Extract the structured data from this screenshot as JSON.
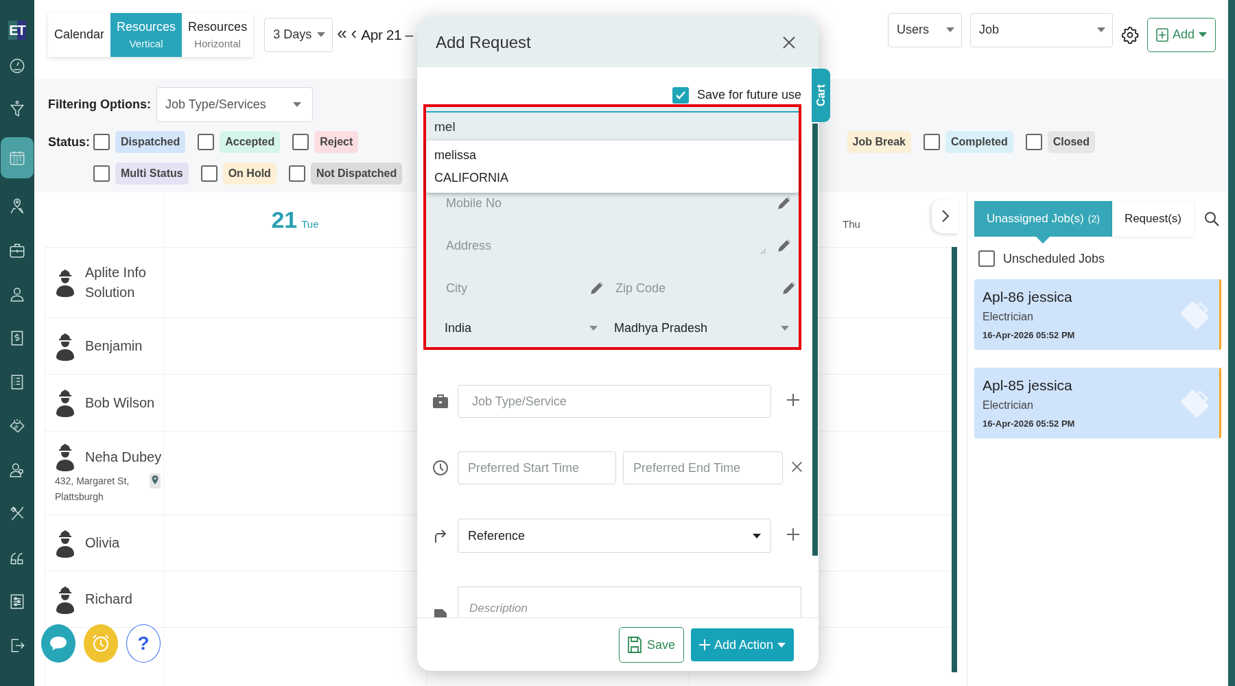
{
  "sidebar": {
    "logo": "ET",
    "items": [
      {
        "kind": "gauge",
        "selected": false
      },
      {
        "kind": "funnel",
        "selected": false
      },
      {
        "kind": "calendar",
        "selected": true
      },
      {
        "kind": "map",
        "selected": false
      },
      {
        "kind": "briefcase",
        "selected": false
      },
      {
        "kind": "person",
        "selected": false
      },
      {
        "kind": "dollar",
        "selected": false
      },
      {
        "kind": "list",
        "selected": false
      },
      {
        "kind": "handshake",
        "selected": false
      },
      {
        "kind": "people",
        "selected": false
      },
      {
        "kind": "tools",
        "selected": false
      },
      {
        "kind": "quote",
        "selected": false
      },
      {
        "kind": "sliders",
        "selected": false
      },
      {
        "kind": "logout",
        "selected": false
      }
    ]
  },
  "view_toggle": [
    {
      "label": "Calendar",
      "selected": false
    },
    {
      "label": "Resources",
      "sublabel": "Vertical",
      "selected": true
    },
    {
      "label": "Resources",
      "sublabel": "Horizontal",
      "selected": false
    }
  ],
  "range_select": "3 Days",
  "nav_buttons": [
    "«",
    "‹"
  ],
  "date_range": "Apr 21 –",
  "users_select": "Users",
  "type_select": "Job",
  "add_button": "Add",
  "filters": {
    "label": "Filtering Options:",
    "select": "Job Type/Services",
    "status_label": "Status:",
    "status_rows": [
      [
        {
          "label": "Dispatched",
          "color": "#d3e5fb",
          "checked": false
        },
        {
          "label": "Accepted",
          "color": "#d5f4ec",
          "checked": false
        },
        {
          "label": "Reject",
          "color": "#fbdde2",
          "checked": false
        },
        {
          "label": "Job Break",
          "color": "#fbefd6"
        },
        {
          "label": "Completed",
          "color": "#d9f0f8",
          "checked": false
        },
        {
          "label": "Closed",
          "color": "#e6e6e6",
          "checked": false
        }
      ],
      [
        {
          "label": "Multi Status",
          "color": "#e4e2f3",
          "checked": false
        },
        {
          "label": "On Hold",
          "color": "#fcefd3",
          "checked": false
        },
        {
          "label": "Not Dispatched",
          "color": "#dadada",
          "checked": false
        }
      ]
    ]
  },
  "day_headers": [
    {
      "number": "21",
      "weekday": "Tue"
    },
    {
      "weekday": "Thu"
    }
  ],
  "resources": [
    {
      "name": "Aplite Info Solution"
    },
    {
      "name": "Benjamin"
    },
    {
      "name": "Bob Wilson"
    },
    {
      "name": "Neha Dubey",
      "address": "432, Margaret St, Plattsburgh"
    },
    {
      "name": "Olivia"
    },
    {
      "name": "Richard"
    }
  ],
  "right_panel": {
    "tabs": [
      {
        "label": "Unassigned Job(s)",
        "count": "(2)",
        "selected": true
      },
      {
        "label": "Request(s)",
        "selected": false
      }
    ],
    "unscheduled": {
      "label": "Unscheduled Jobs",
      "checked": false
    },
    "jobs": [
      {
        "title": "Apl-86 jessica",
        "type": "Electrician",
        "time": "16-Apr-2026 05:52 PM"
      },
      {
        "title": "Apl-85 jessica",
        "type": "Electrician",
        "time": "16-Apr-2026 05:52 PM"
      }
    ]
  },
  "floating_buttons": [
    {
      "kind": "chat"
    },
    {
      "kind": "alarm"
    },
    {
      "kind": "help",
      "label": "?"
    }
  ],
  "modal": {
    "title": "Add Request",
    "cart_tab": "Cart",
    "save_for_future": {
      "label": "Save for future use",
      "checked": true
    },
    "customer_search": {
      "value": "mel"
    },
    "suggestions": [
      "melissa",
      "CALIFORNIA"
    ],
    "mobile": {
      "placeholder": "Mobile No"
    },
    "address": {
      "placeholder": "Address"
    },
    "city": {
      "placeholder": "City"
    },
    "zip": {
      "placeholder": "Zip Code"
    },
    "country": "India",
    "state": "Madhya Pradesh",
    "job_type": {
      "placeholder": "Job Type/Service"
    },
    "start_time": {
      "placeholder": "Preferred Start Time"
    },
    "end_time": {
      "placeholder": "Preferred End Time"
    },
    "reference": "Reference",
    "description": {
      "placeholder": "Description"
    },
    "save_button": "Save",
    "add_action_button": "Add Action"
  }
}
